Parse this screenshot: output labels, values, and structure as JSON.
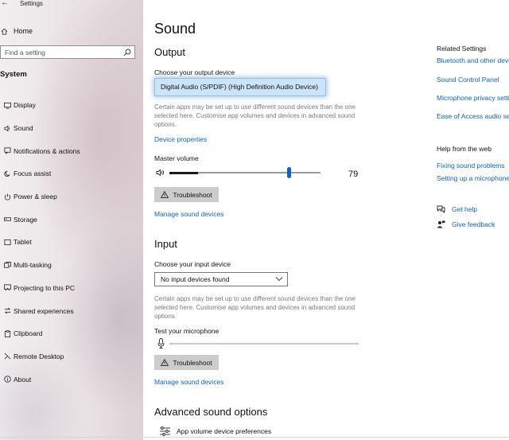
{
  "window": {
    "title": "Settings"
  },
  "sidebar": {
    "home_label": "Home",
    "search_placeholder": "Find a setting",
    "section_title": "System",
    "items": [
      {
        "label": "Display",
        "icon": "display-icon"
      },
      {
        "label": "Sound",
        "icon": "sound-icon"
      },
      {
        "label": "Notifications & actions",
        "icon": "notifications-icon"
      },
      {
        "label": "Focus assist",
        "icon": "focus-assist-icon"
      },
      {
        "label": "Power & sleep",
        "icon": "power-icon"
      },
      {
        "label": "Storage",
        "icon": "storage-icon"
      },
      {
        "label": "Tablet",
        "icon": "tablet-icon"
      },
      {
        "label": "Multi-tasking",
        "icon": "multitasking-icon"
      },
      {
        "label": "Projecting to this PC",
        "icon": "projecting-icon"
      },
      {
        "label": "Shared experiences",
        "icon": "shared-experiences-icon"
      },
      {
        "label": "Clipboard",
        "icon": "clipboard-icon"
      },
      {
        "label": "Remote Desktop",
        "icon": "remote-desktop-icon"
      },
      {
        "label": "About",
        "icon": "about-icon"
      }
    ]
  },
  "main": {
    "title": "Sound",
    "output": {
      "heading": "Output",
      "device_label": "Choose your output device",
      "device_selected": "Digital Audio (S/PDIF) (High Definition Audio Device)",
      "description": "Certain apps may be set up to use different sound devices than the one selected here. Customise app volumes and devices in advanced sound options.",
      "device_properties_link": "Device properties",
      "master_volume_label": "Master volume",
      "master_volume_value": "79",
      "master_volume_level": 0.79,
      "master_volume_peak": 0.19,
      "troubleshoot_label": "Troubleshoot",
      "manage_link": "Manage sound devices"
    },
    "input": {
      "heading": "Input",
      "device_label": "Choose your input device",
      "device_selected": "No input devices found",
      "description": "Certain apps may be set up to use different sound devices than the one selected here. Customise app volumes and devices in advanced sound options.",
      "test_label": "Test your microphone",
      "troubleshoot_label": "Troubleshoot",
      "manage_link": "Manage sound devices"
    },
    "advanced": {
      "heading": "Advanced sound options",
      "app_volume_label": "App volume  device preferences"
    }
  },
  "related": {
    "heading": "Related Settings",
    "links": [
      "Bluetooth and other devices",
      "Sound Control Panel",
      "Microphone privacy settings",
      "Ease of Access audio settings"
    ],
    "help_heading": "Help from the web",
    "help_links": [
      "Fixing sound problems",
      "Setting up a microphone"
    ],
    "get_help": "Get help",
    "give_feedback": "Give feedback"
  },
  "colors": {
    "accent": "#0a63c4",
    "dropdown_highlight": "#cce4f7",
    "button_bg": "#cccccc"
  }
}
